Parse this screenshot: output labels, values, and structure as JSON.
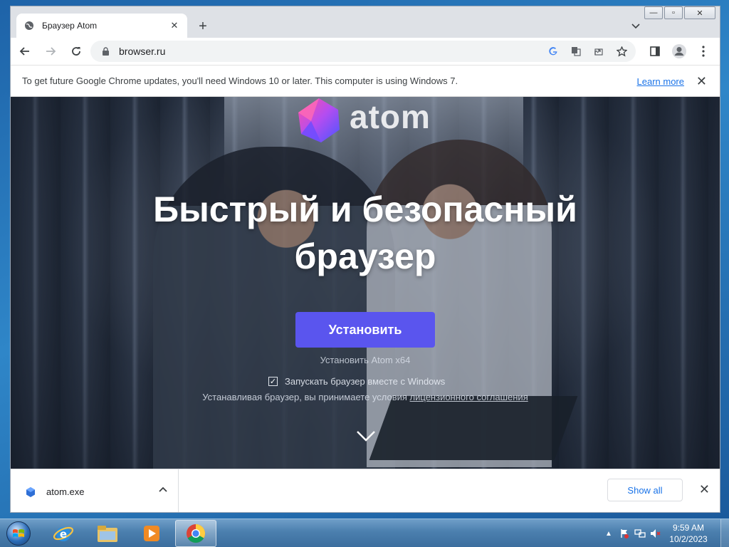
{
  "browser": {
    "tab_title": "Браузер Atom",
    "tab_close": "✕",
    "new_tab": "+",
    "url": "browser.ru",
    "window_controls": {
      "minimize": "—",
      "maximize": "▫",
      "close": "✕"
    }
  },
  "infobar": {
    "message": "To get future Google Chrome updates, you'll need Windows 10 or later. This computer is using Windows 7.",
    "learn_more": "Learn more",
    "close": "✕"
  },
  "page": {
    "logo_text": "atom",
    "headline_line1": "Быстрый и безопасный",
    "headline_line2": "браузер",
    "install_button": "Установить",
    "install_sub": "Установить Atom x64",
    "checkbox_label": "Запускать браузер вместе с Windows",
    "terms_prefix": "Устанавливая браузер, вы принимаете условия ",
    "terms_link": "лицензионного соглашения",
    "accent_color": "#5a55ee"
  },
  "downloads": {
    "file_name": "atom.exe",
    "show_all": "Show all",
    "close": "✕"
  },
  "taskbar": {
    "time": "9:59 AM",
    "date": "10/2/2023",
    "tray_arrow": "▲"
  }
}
